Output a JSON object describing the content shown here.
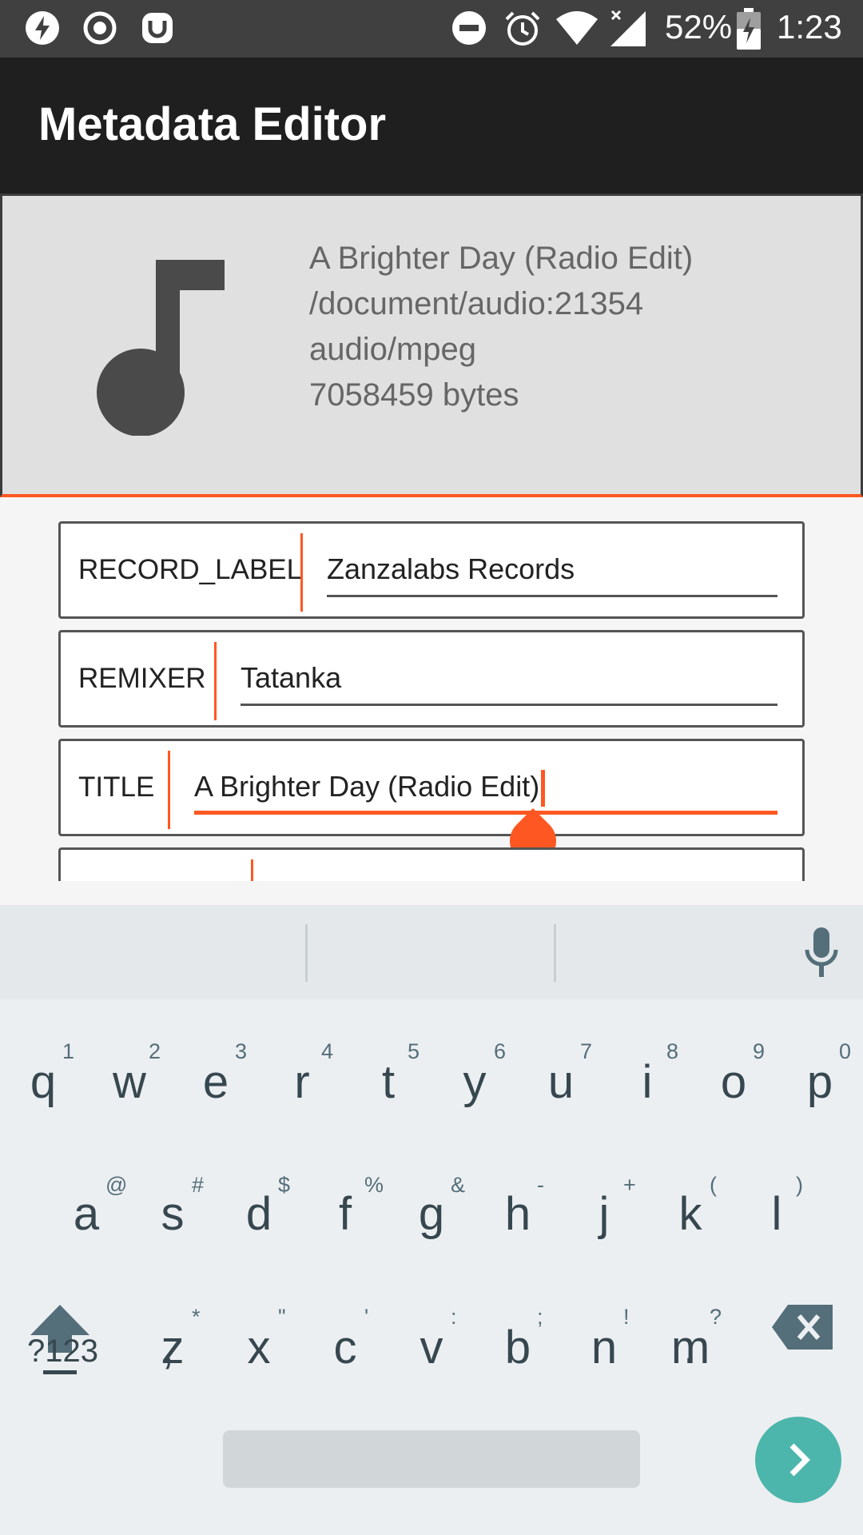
{
  "status_bar": {
    "battery_percent": "52%",
    "time": "1:23",
    "icons": [
      "flash-icon",
      "record-icon",
      "shield-app-icon",
      "do-not-disturb-icon",
      "alarm-icon",
      "wifi-icon",
      "signal-icon",
      "battery-icon"
    ]
  },
  "app_bar": {
    "title": "Metadata Editor"
  },
  "file_info": {
    "icon": "music-note-icon",
    "title": "A Brighter Day (Radio Edit)",
    "path": "/document/audio:21354",
    "mime": "audio/mpeg",
    "size": "7058459 bytes"
  },
  "fields": [
    {
      "label": "RECORD_LABEL",
      "value": "Zanzalabs Records"
    },
    {
      "label": "REMIXER",
      "value": "Tatanka"
    },
    {
      "label": "TITLE",
      "value": "A Brighter Day (Radio Edit)"
    },
    {
      "label": "",
      "value": ""
    }
  ],
  "keyboard": {
    "row1": [
      {
        "key": "q",
        "hint": "1"
      },
      {
        "key": "w",
        "hint": "2"
      },
      {
        "key": "e",
        "hint": "3"
      },
      {
        "key": "r",
        "hint": "4"
      },
      {
        "key": "t",
        "hint": "5"
      },
      {
        "key": "y",
        "hint": "6"
      },
      {
        "key": "u",
        "hint": "7"
      },
      {
        "key": "i",
        "hint": "8"
      },
      {
        "key": "o",
        "hint": "9"
      },
      {
        "key": "p",
        "hint": "0"
      }
    ],
    "row2": [
      {
        "key": "a",
        "hint": "@"
      },
      {
        "key": "s",
        "hint": "#"
      },
      {
        "key": "d",
        "hint": "$"
      },
      {
        "key": "f",
        "hint": "%"
      },
      {
        "key": "g",
        "hint": "&"
      },
      {
        "key": "h",
        "hint": "-"
      },
      {
        "key": "j",
        "hint": "+"
      },
      {
        "key": "k",
        "hint": "("
      },
      {
        "key": "l",
        "hint": ")"
      }
    ],
    "row3": [
      {
        "key": "z",
        "hint": "*"
      },
      {
        "key": "x",
        "hint": "\""
      },
      {
        "key": "c",
        "hint": "'"
      },
      {
        "key": "v",
        "hint": ":"
      },
      {
        "key": "b",
        "hint": ";"
      },
      {
        "key": "n",
        "hint": "!"
      },
      {
        "key": "m",
        "hint": "?"
      }
    ],
    "symbols_label": "?123",
    "comma": ",",
    "period": "."
  },
  "colors": {
    "accent": "#ff5722",
    "enter": "#4db6ac",
    "appbar": "#1f1f1f",
    "statusbar": "#404040"
  }
}
